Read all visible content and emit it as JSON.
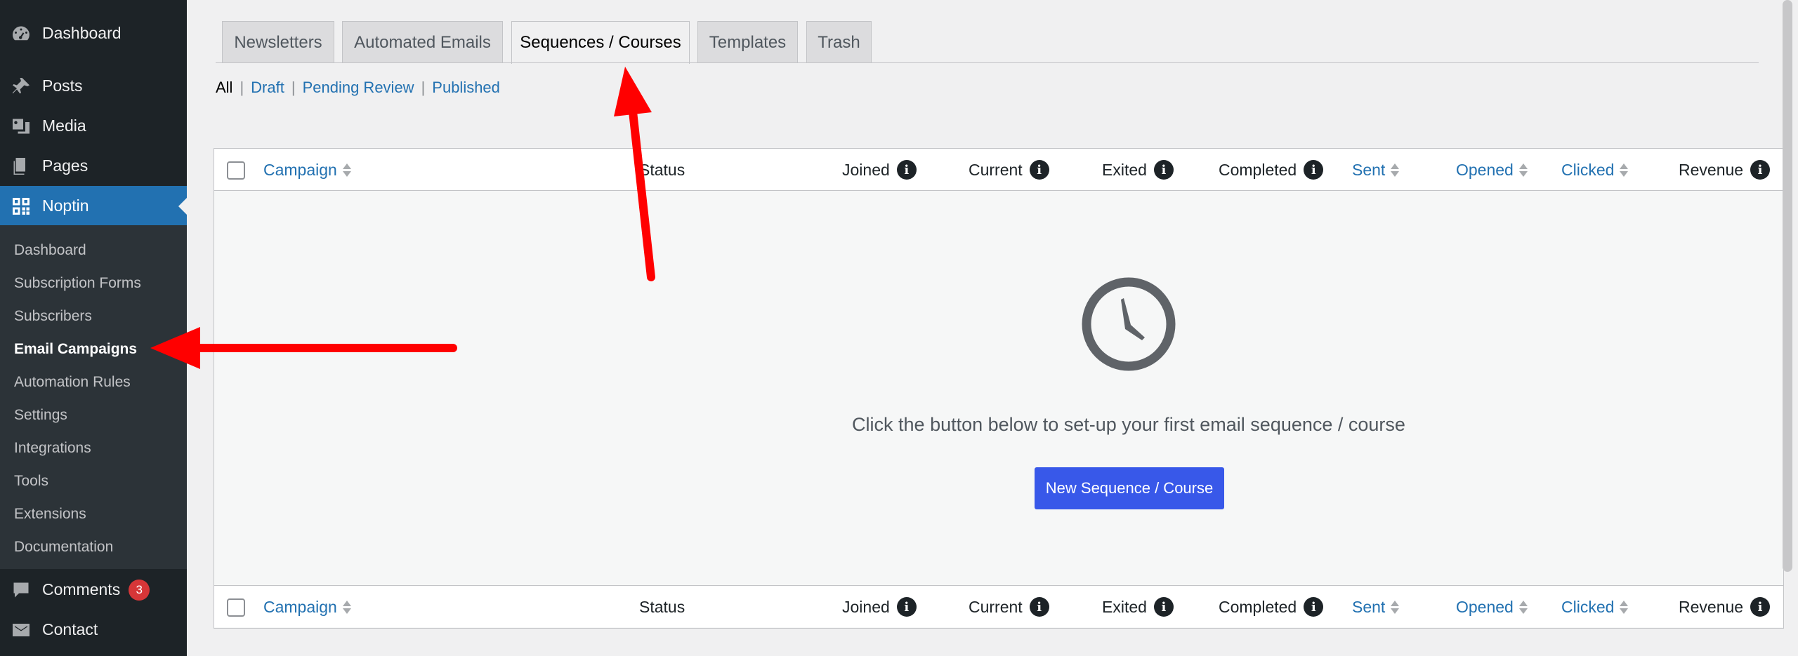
{
  "sidebar": {
    "top_items": [
      {
        "label": "Dashboard",
        "icon": "dashboard-icon"
      },
      {
        "label": "Posts",
        "icon": "pin-icon"
      },
      {
        "label": "Media",
        "icon": "media-icon"
      },
      {
        "label": "Pages",
        "icon": "pages-icon"
      },
      {
        "label": "Noptin",
        "icon": "noptin-icon"
      }
    ],
    "submenu": [
      "Dashboard",
      "Subscription Forms",
      "Subscribers",
      "Email Campaigns",
      "Automation Rules",
      "Settings",
      "Integrations",
      "Tools",
      "Extensions",
      "Documentation"
    ],
    "bottom_items": [
      {
        "label": "Comments",
        "icon": "comments-icon",
        "badge": "3"
      },
      {
        "label": "Contact",
        "icon": "mail-icon"
      }
    ]
  },
  "tabs": [
    "Newsletters",
    "Automated Emails",
    "Sequences / Courses",
    "Templates",
    "Trash"
  ],
  "filters": {
    "all": "All",
    "draft": "Draft",
    "pending": "Pending Review",
    "published": "Published",
    "sep": "|"
  },
  "columns": {
    "campaign": "Campaign",
    "status": "Status",
    "joined": "Joined",
    "current": "Current",
    "exited": "Exited",
    "completed": "Completed",
    "sent": "Sent",
    "opened": "Opened",
    "clicked": "Clicked",
    "revenue": "Revenue",
    "info_glyph": "i"
  },
  "empty_state": {
    "message": "Click the button below to set-up your first email sequence / course",
    "button": "New Sequence / Course",
    "icon": "clock-icon"
  },
  "colors": {
    "sidebar_bg": "#1d2327",
    "accent": "#2271b1",
    "button": "#3858e9",
    "arrow": "#ff0000",
    "badge": "#d63638"
  }
}
